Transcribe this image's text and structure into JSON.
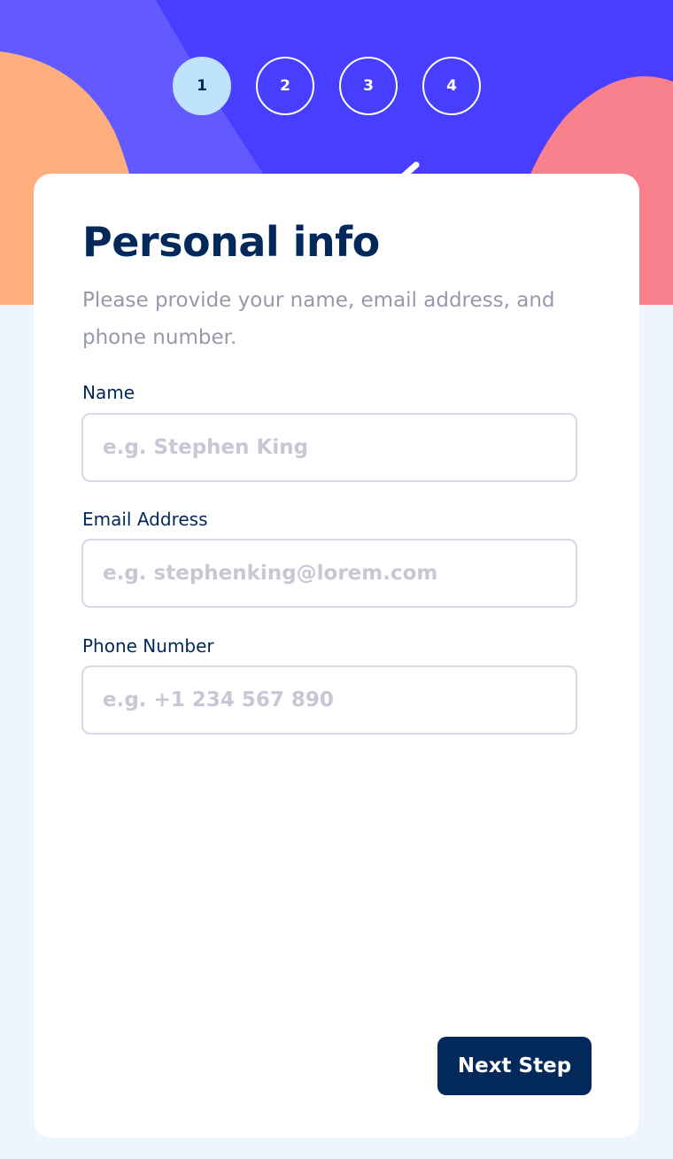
{
  "steps": [
    {
      "number": "1",
      "active": true
    },
    {
      "number": "2",
      "active": false
    },
    {
      "number": "3",
      "active": false
    },
    {
      "number": "4",
      "active": false
    }
  ],
  "form": {
    "title": "Personal info",
    "description": "Please provide your name, email address, and phone number.",
    "fields": [
      {
        "label": "Name",
        "placeholder": "e.g. Stephen King",
        "value": ""
      },
      {
        "label": "Email Address",
        "placeholder": "e.g. stephenking@lorem.com",
        "value": ""
      },
      {
        "label": "Phone Number",
        "placeholder": "e.g. +1 234 567 890",
        "value": ""
      }
    ]
  },
  "buttons": {
    "next_label": "Next Step"
  },
  "colors": {
    "header_purple": "#483eff",
    "header_violet": "#6259ff",
    "blob_orange": "#ffaf7e",
    "blob_pink": "#f9818e",
    "active_step": "#bfe2fd",
    "marine_blue": "#02295a",
    "page_bg": "#eff5ff"
  }
}
